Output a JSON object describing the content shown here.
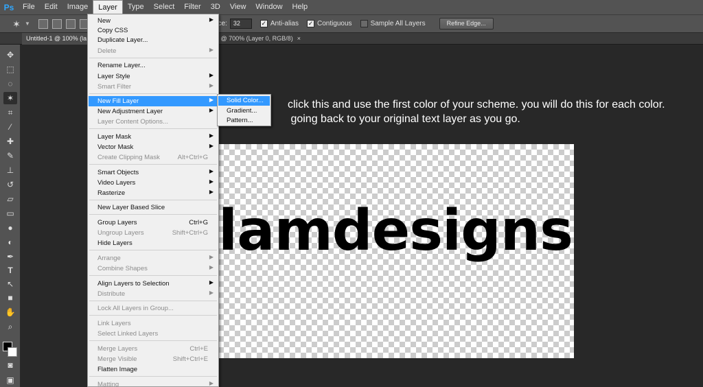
{
  "app_logo": "Ps",
  "menubar": [
    "File",
    "Edit",
    "Image",
    "Layer",
    "Type",
    "Select",
    "Filter",
    "3D",
    "View",
    "Window",
    "Help"
  ],
  "options": {
    "tolerance_label": "nce:",
    "tolerance_value": "32",
    "anti_alias": "Anti-alias",
    "contiguous": "Contiguous",
    "sample_all": "Sample All Layers",
    "refine_edge": "Refine Edge..."
  },
  "tabs": {
    "tab1": "Untitled-1 @ 100% (la",
    "tab2": "g @ 700% (Layer 0, RGB/8)",
    "close": "×"
  },
  "layer_menu": {
    "new": "New",
    "copy_css": "Copy CSS",
    "duplicate": "Duplicate Layer...",
    "delete": "Delete",
    "rename": "Rename Layer...",
    "layer_style": "Layer Style",
    "smart_filter": "Smart Filter",
    "new_fill": "New Fill Layer",
    "new_adjustment": "New Adjustment Layer",
    "layer_content": "Layer Content Options...",
    "layer_mask": "Layer Mask",
    "vector_mask": "Vector Mask",
    "clipping_mask": "Create Clipping Mask",
    "clipping_mask_sc": "Alt+Ctrl+G",
    "smart_objects": "Smart Objects",
    "video_layers": "Video Layers",
    "rasterize": "Rasterize",
    "layer_slice": "New Layer Based Slice",
    "group": "Group Layers",
    "group_sc": "Ctrl+G",
    "ungroup": "Ungroup Layers",
    "ungroup_sc": "Shift+Ctrl+G",
    "hide": "Hide Layers",
    "arrange": "Arrange",
    "combine": "Combine Shapes",
    "align": "Align Layers to Selection",
    "distribute": "Distribute",
    "lock_all": "Lock All Layers in Group...",
    "link": "Link Layers",
    "select_linked": "Select Linked Layers",
    "merge": "Merge Layers",
    "merge_sc": "Ctrl+E",
    "merge_visible": "Merge Visible",
    "merge_visible_sc": "Shift+Ctrl+E",
    "flatten": "Flatten Image",
    "matting": "Matting"
  },
  "fill_submenu": {
    "solid": "Solid Color...",
    "gradient": "Gradient...",
    "pattern": "Pattern..."
  },
  "instruction": "click this and use the first color of your scheme. you will do this for each color.\n going back to your original text layer as you go.",
  "canvas_text": "lamdesigns",
  "colors": {
    "highlight": "#3399ff",
    "foreground": "#000000",
    "background": "#ffffff"
  }
}
